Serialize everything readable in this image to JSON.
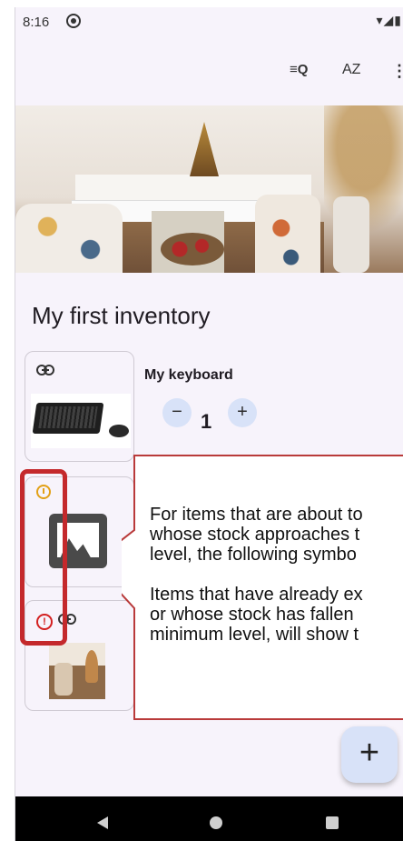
{
  "status_bar": {
    "time": "8:16",
    "signal": "▾◢▮"
  },
  "app_bar": {
    "actions": [
      "≡Q",
      "AZ",
      "⋮"
    ],
    "icons": [
      "filter-search-icon",
      "sort-az-icon",
      "more-vert-icon"
    ]
  },
  "inventory": {
    "title": "My first inventory"
  },
  "items": [
    {
      "name": "My keyboard",
      "quantity": "1",
      "minus_label": "−",
      "plus_label": "+",
      "icon": "link-icon"
    },
    {
      "name": "",
      "icon": "alarm-icon"
    },
    {
      "name": "",
      "icon": "error-icon",
      "error_glyph": "!"
    }
  ],
  "callout": {
    "paragraph_1": [
      "For items that are about to",
      "whose stock approaches t",
      "level, the following symbo"
    ],
    "paragraph_2": [
      "Items that have already ex",
      "or whose stock has fallen",
      "minimum level, will show t"
    ]
  },
  "fab": {
    "label": "+"
  },
  "colors": {
    "highlight": "#c4292c",
    "accent": "#d8e2f8",
    "alarm": "#e2a017",
    "error": "#d32020"
  }
}
